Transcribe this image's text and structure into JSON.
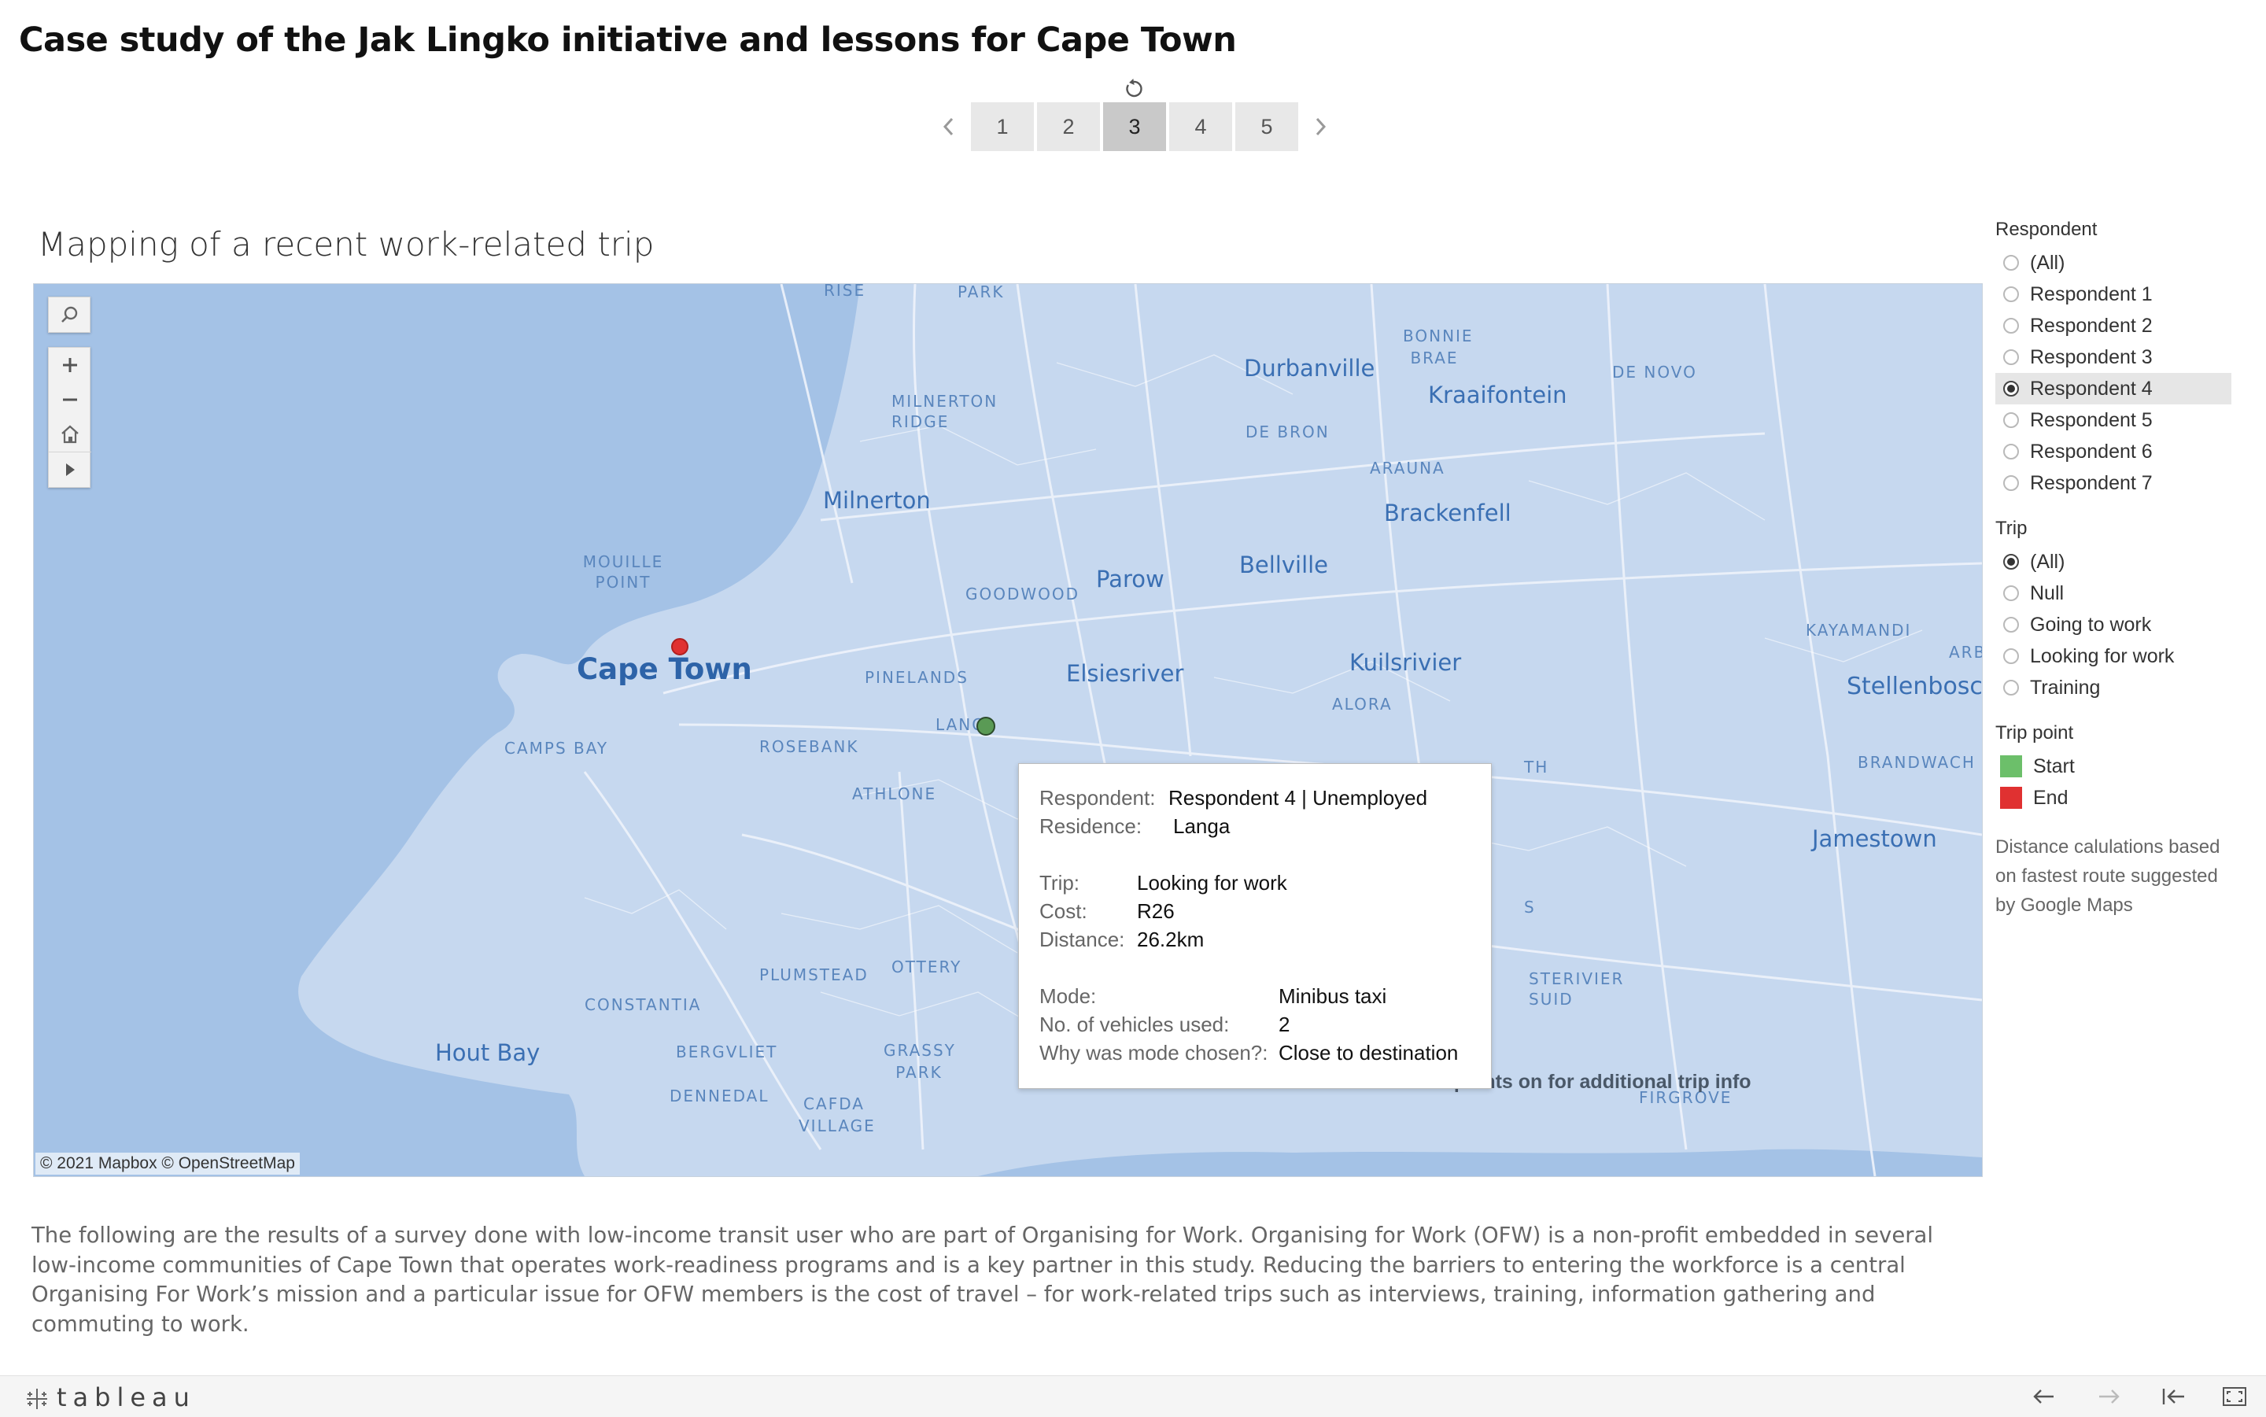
{
  "header": {
    "title": "Case study of the Jak Lingko initiative and lessons for Cape Town"
  },
  "pager": {
    "pages": [
      "1",
      "2",
      "3",
      "4",
      "5"
    ],
    "active_page": "3"
  },
  "section_title": "Mapping of a recent work-related trip",
  "map": {
    "places": {
      "cape_town": "Cape Town",
      "milnerton": "Milnerton",
      "milnerton_ridge": "MILNERTON RIDGE",
      "mouille_point": "MOUILLE POINT",
      "camps_bay": "CAMPS BAY",
      "durbanville": "Durbanville",
      "kraaifontein": "Kraaifontein",
      "bonnie_brae": "BONNIE BRAE",
      "de_novo": "DE NOVO",
      "de_bron": "DE BRON",
      "arauna": "ARAUNA",
      "brackenfell": "Brackenfell",
      "parow": "Parow",
      "bellville": "Bellville",
      "goodwood": "GOODWOOD",
      "pinelands": "PINELANDS",
      "elsiesriver": "Elsiesriver",
      "kuilsrivier": "Kuilsrivier",
      "alora": "ALORA",
      "rosebank": "ROSEBANK",
      "langa": "LANG",
      "athlone": "ATHLONE",
      "kayamandi": "KAYAMANDI",
      "stellenbosch": "Stellenbosch",
      "arbi": "ARBI",
      "brandwach": "BRANDWACH",
      "jamestown": "Jamestown",
      "constantia": "CONSTANTIA",
      "hout_bay": "Hout Bay",
      "plumstead": "PLUMSTEAD",
      "ottery": "OTTERY",
      "bergvliet": "BERGVLIET",
      "grassy_park": "GRASSY PARK",
      "dennedal": "DENNEDAL",
      "cafda_village": "CAFDA VILLAGE",
      "rise": "RISE",
      "park": "PARK",
      "sterivier_suid": "STERIVIER SUID",
      "firgrove": "FIRGROVE",
      "s_fragment": "S",
      "th_fragment": "TH"
    },
    "attribution": "© 2021 Mapbox  © OpenStreetMap",
    "hover_note": "...points on for additional trip info",
    "tools": [
      "search-icon",
      "zoom-in-icon",
      "zoom-out-icon",
      "home-icon",
      "play-icon"
    ]
  },
  "tooltip": {
    "respondent_label": "Respondent:",
    "respondent_value": "Respondent 4 | Unemployed",
    "residence_label": "Residence:",
    "residence_value": "Langa",
    "trip_label": "Trip:",
    "trip_value": "Looking for work",
    "cost_label": "Cost:",
    "cost_value": "R26",
    "distance_label": "Distance:",
    "distance_value": "26.2km",
    "mode_label": "Mode:",
    "mode_value": "Minibus taxi",
    "vehicles_label": "No. of vehicles used:",
    "vehicles_value": "2",
    "why_label": "Why was mode chosen?:",
    "why_value": "Close to destination"
  },
  "filters": {
    "respondent": {
      "title": "Respondent",
      "options": [
        "(All)",
        "Respondent 1",
        "Respondent 2",
        "Respondent 3",
        "Respondent 4",
        "Respondent 5",
        "Respondent 6",
        "Respondent 7"
      ],
      "selected": "Respondent 4"
    },
    "trip": {
      "title": "Trip",
      "options": [
        "(All)",
        "Null",
        "Going to work",
        "Looking for work",
        "Training"
      ],
      "selected": "(All)"
    },
    "trip_point": {
      "title": "Trip point",
      "items": [
        {
          "label": "Start",
          "color": "#6cbf6a"
        },
        {
          "label": "End",
          "color": "#e03131"
        }
      ]
    },
    "note": "Distance calulations based on fastest route suggested by Google Maps"
  },
  "description": "The following are the results of a survey done with low-income transit user who are part of Organising for Work. Organising for Work (OFW) is a non-profit embedded in several low-income communities of Cape Town that operates work-readiness programs and is a key partner in this study.  Reducing the barriers to entering the workforce is a central Organising For Work’s mission and a particular issue for OFW members is the cost of travel – for work-related trips such as interviews, training, information gathering and commuting to work.",
  "footer": {
    "logo": "tableau"
  },
  "colors": {
    "map_land": "#c6d8ef",
    "map_water": "#a4c2e6",
    "end": "#e03131",
    "start": "#5a9a55"
  }
}
